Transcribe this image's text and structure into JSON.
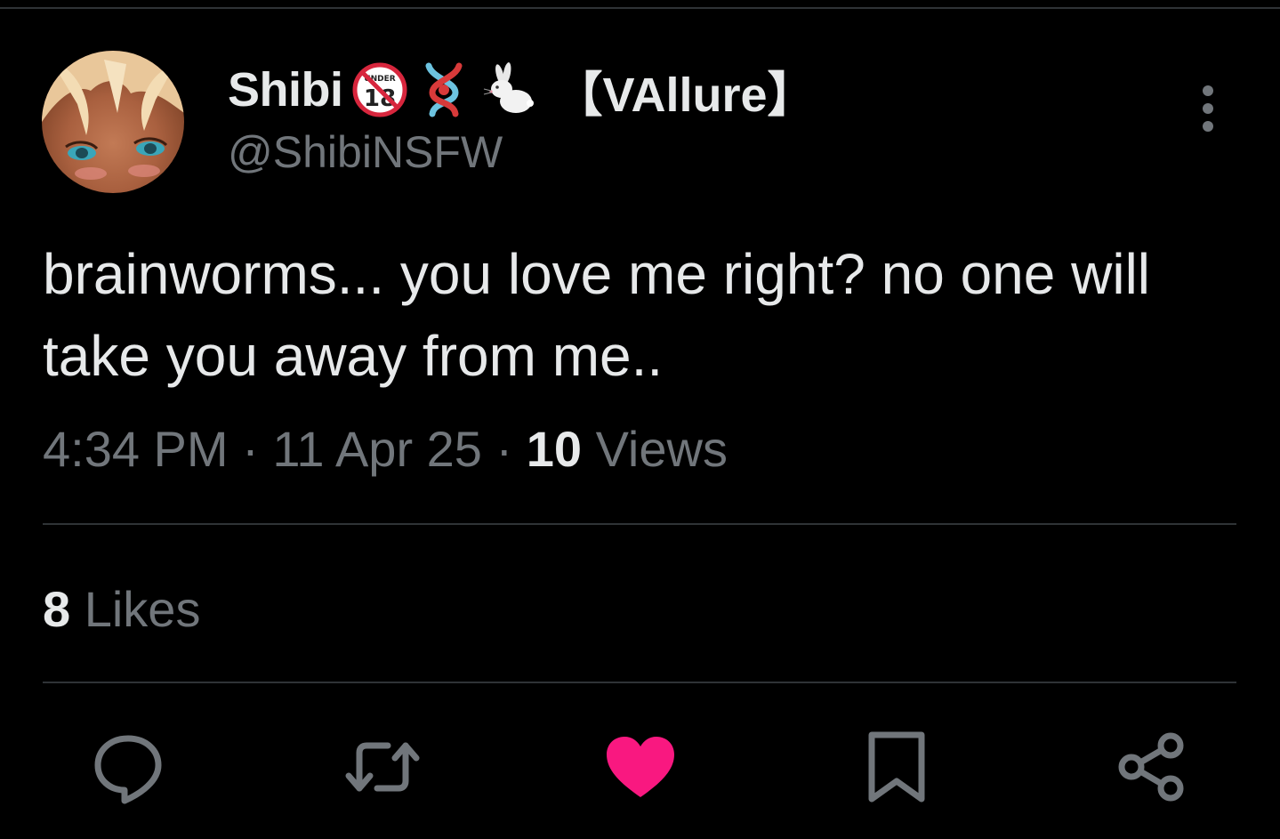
{
  "author": {
    "display_name": "Shibi",
    "badge_emojis": [
      "underage-18-icon",
      "knot-icon",
      "rabbit-icon"
    ],
    "brand_tag": "【VAllure】",
    "handle": "@ShibiNSFW",
    "avatar": "avatar"
  },
  "tweet": {
    "text": "brainworms... you love me right? no one will take you away from me.."
  },
  "meta": {
    "time": "4:34 PM",
    "separator": "·",
    "date": "11 Apr 25",
    "views_count": "10",
    "views_label": "Views"
  },
  "engagement": {
    "likes_count": "8",
    "likes_label": "Likes"
  },
  "actions": [
    {
      "icon": "reply-icon"
    },
    {
      "icon": "retweet-icon"
    },
    {
      "icon": "like-icon-filled"
    },
    {
      "icon": "bookmark-icon"
    },
    {
      "icon": "share-icon"
    }
  ],
  "colors": {
    "background": "#000000",
    "primary_text": "#e7e9ea",
    "secondary_text": "#71767b",
    "divider": "#2f3336",
    "like_active": "#f91880"
  }
}
